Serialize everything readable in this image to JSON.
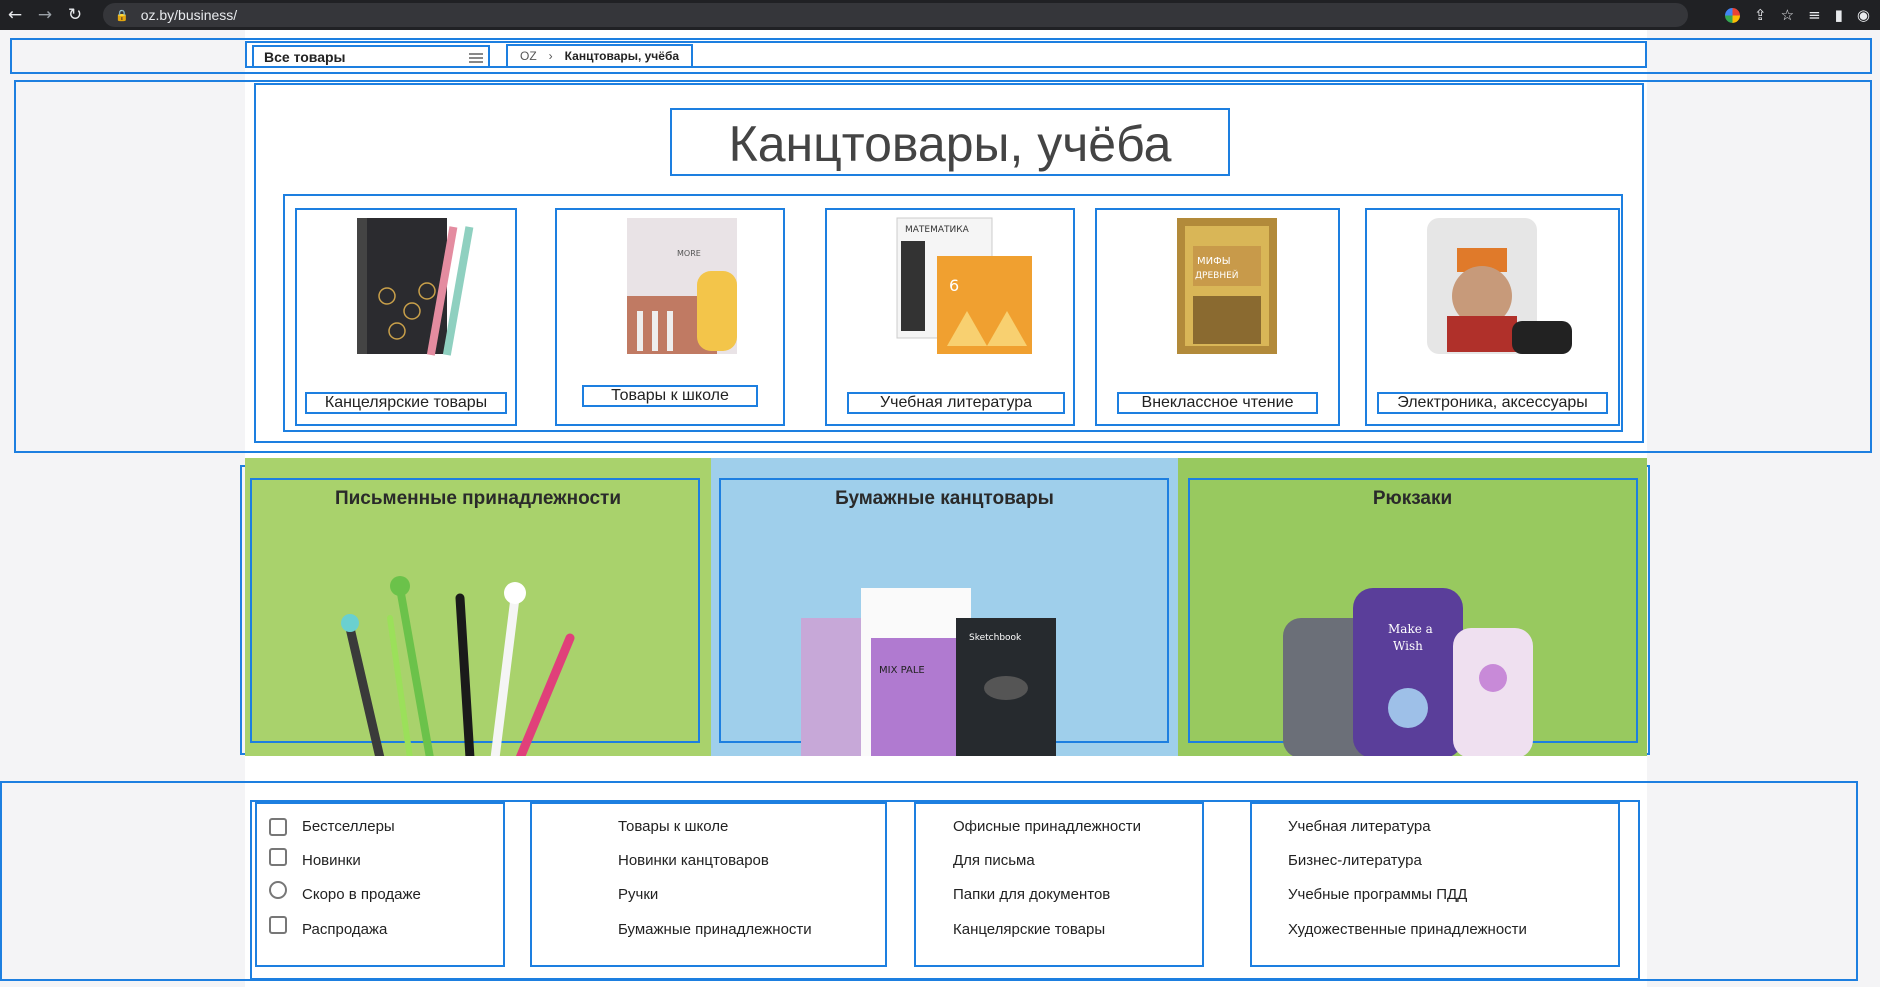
{
  "browser": {
    "url": "oz.by/business/",
    "back_icon": "arrow-left-icon",
    "forward_icon": "arrow-right-icon",
    "reload_icon": "reload-icon"
  },
  "topbar": {
    "all_goods": "Все товары",
    "breadcrumb_home": "OZ",
    "breadcrumb_sep": "›",
    "breadcrumb_current": "Канцтовары, учёба"
  },
  "hero": {
    "title": "Канцтовары, учёба"
  },
  "categories": [
    {
      "label": "Канцелярские товары"
    },
    {
      "label": "Товары к школе"
    },
    {
      "label": "Учебная литература"
    },
    {
      "label": "Внеклассное чтение"
    },
    {
      "label": "Электроника, аксессуары"
    }
  ],
  "banners": [
    {
      "title": "Письменные принадлежности",
      "color": "#a9d26c"
    },
    {
      "title": "Бумажные канцтовары",
      "color": "#9fcfeb"
    },
    {
      "title": "Рюкзаки",
      "color": "#98c95f"
    }
  ],
  "links": {
    "col1": [
      "Бестселлеры",
      "Новинки",
      "Скоро в продаже",
      "Распродажа"
    ],
    "col2": [
      "Товары к школе",
      "Новинки канцтоваров",
      "Ручки",
      "Бумажные принадлежности"
    ],
    "col3": [
      "Офисные принадлежности",
      "Для письма",
      "Папки для документов",
      "Канцелярские товары"
    ],
    "col4": [
      "Учебная литература",
      "Бизнес-литература",
      "Учебные программы ПДД",
      "Художественные принадлежности"
    ]
  }
}
